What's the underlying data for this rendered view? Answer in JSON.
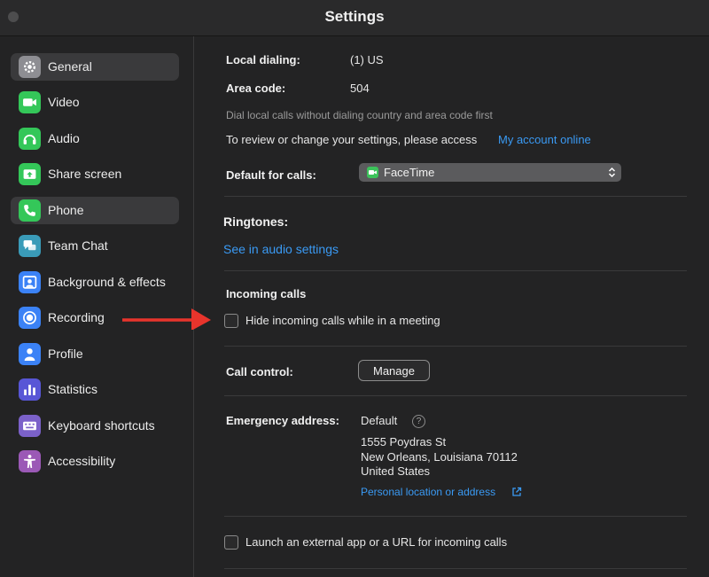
{
  "window": {
    "title": "Settings"
  },
  "sidebar": {
    "items": [
      {
        "label": "General",
        "icon": "gear-icon",
        "color": "#8e8e93",
        "active": true
      },
      {
        "label": "Video",
        "icon": "video-camera-icon",
        "color": "#34c759",
        "active": false
      },
      {
        "label": "Audio",
        "icon": "headphones-icon",
        "color": "#34c759",
        "active": false
      },
      {
        "label": "Share screen",
        "icon": "share-screen-icon",
        "color": "#34c759",
        "active": false
      },
      {
        "label": "Phone",
        "icon": "phone-icon",
        "color": "#34c759",
        "active": true
      },
      {
        "label": "Team Chat",
        "icon": "chat-icon",
        "color": "#3a9bb8",
        "active": false
      },
      {
        "label": "Background & effects",
        "icon": "background-icon",
        "color": "#3b82f6",
        "active": false
      },
      {
        "label": "Recording",
        "icon": "recording-icon",
        "color": "#3b82f6",
        "active": false
      },
      {
        "label": "Profile",
        "icon": "profile-icon",
        "color": "#3b82f6",
        "active": false
      },
      {
        "label": "Statistics",
        "icon": "statistics-icon",
        "color": "#5856d6",
        "active": false
      },
      {
        "label": "Keyboard shortcuts",
        "icon": "keyboard-icon",
        "color": "#7b61c9",
        "active": false
      },
      {
        "label": "Accessibility",
        "icon": "accessibility-icon",
        "color": "#9b59b6",
        "active": false
      }
    ]
  },
  "phone": {
    "local_dialing_label": "Local dialing:",
    "local_dialing_value": "(1) US",
    "area_code_label": "Area code:",
    "area_code_value": "504",
    "dial_hint": "Dial local calls without dialing country and area code first",
    "review_text": "To review or change your settings, please access",
    "account_link": "My account online",
    "default_calls_label": "Default for calls:",
    "default_calls_value": "FaceTime",
    "ringtones_title": "Ringtones:",
    "ringtones_link": "See in audio settings",
    "incoming_title": "Incoming calls",
    "hide_incoming_label": "Hide incoming calls while in a meeting",
    "hide_incoming_checked": false,
    "call_control_label": "Call control:",
    "manage_button": "Manage",
    "emergency_label": "Emergency address:",
    "emergency_default": "Default",
    "help_glyph": "?",
    "address_line1": "1555 Poydras St",
    "address_line2": "New Orleans, Louisiana 70112",
    "address_line3": "United States",
    "personal_location_link": "Personal location or address",
    "launch_external_label": "Launch an external app or a URL for incoming calls",
    "launch_external_checked": false
  },
  "annotation": {
    "arrow_color": "#e8342c"
  },
  "colors": {
    "accent_link": "#3a9af4",
    "facetime_green": "#3cc25a"
  }
}
